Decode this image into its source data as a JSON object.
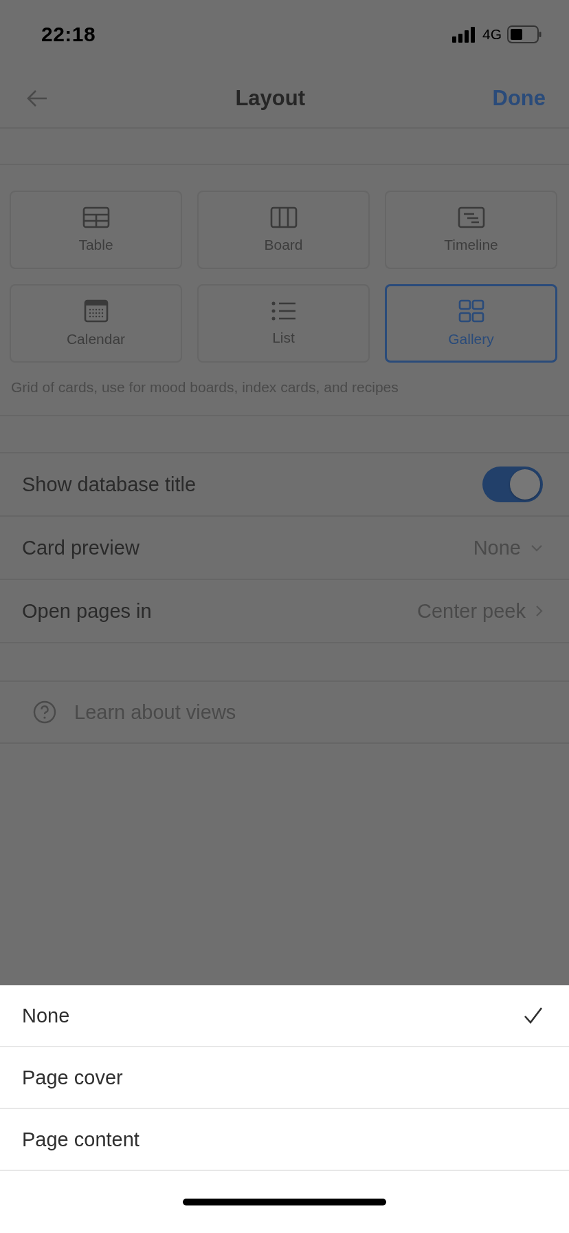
{
  "status_bar": {
    "time": "22:18",
    "network": "4G"
  },
  "nav": {
    "title": "Layout",
    "action": "Done"
  },
  "layouts": [
    {
      "label": "Table",
      "kind": "table",
      "selected": false
    },
    {
      "label": "Board",
      "kind": "board",
      "selected": false
    },
    {
      "label": "Timeline",
      "kind": "timeline",
      "selected": false
    },
    {
      "label": "Calendar",
      "kind": "calendar",
      "selected": false
    },
    {
      "label": "List",
      "kind": "list",
      "selected": false
    },
    {
      "label": "Gallery",
      "kind": "gallery",
      "selected": true
    }
  ],
  "description": "Grid of cards, use for mood boards, index cards, and recipes",
  "settings": [
    {
      "kind": "toggle",
      "label": "Show database title",
      "on": true
    },
    {
      "kind": "select",
      "label": "Card preview",
      "value": "None"
    },
    {
      "kind": "link",
      "label": "Open pages in",
      "value": "Center peek"
    }
  ],
  "help": "Learn about views",
  "sheet": [
    {
      "label": "None",
      "selected": true
    },
    {
      "label": "Page cover",
      "selected": false
    },
    {
      "label": "Page content",
      "selected": false
    }
  ]
}
